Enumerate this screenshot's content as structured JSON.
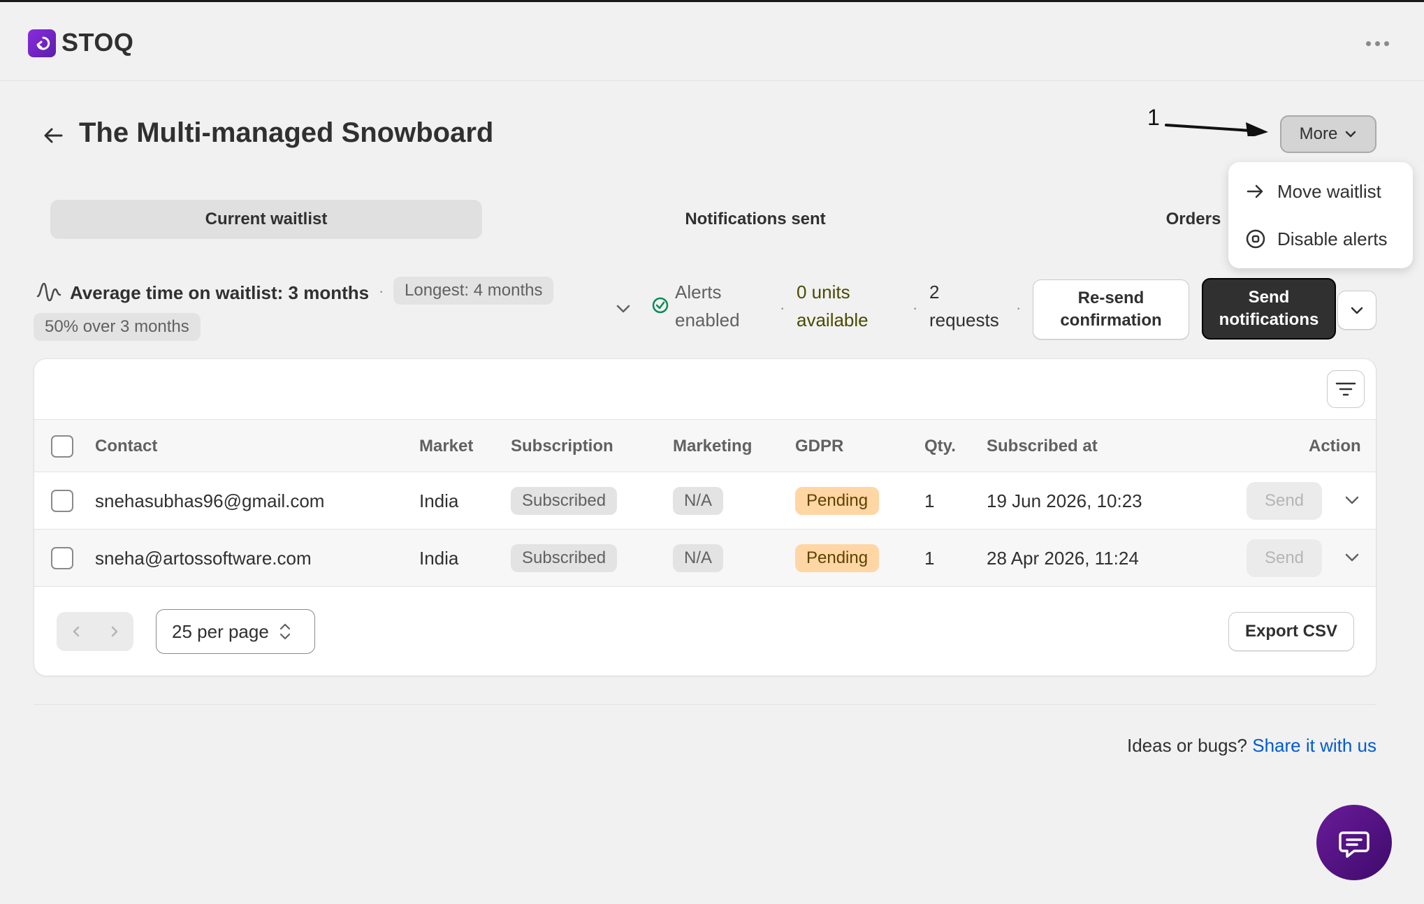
{
  "app": {
    "name": "STOQ"
  },
  "page": {
    "title": "The Multi-managed Snowboard"
  },
  "annotation": {
    "number": "1"
  },
  "more_menu": {
    "label": "More",
    "items": [
      {
        "label": "Move waitlist",
        "icon": "arrow-right-icon"
      },
      {
        "label": "Disable alerts",
        "icon": "stop-circle-icon"
      }
    ]
  },
  "tabs": [
    {
      "label": "Current waitlist",
      "active": true
    },
    {
      "label": "Notifications sent",
      "active": false
    },
    {
      "label": "Orders",
      "active": false
    }
  ],
  "stats": {
    "avg_label": "Average time on waitlist: 3 months",
    "longest": "Longest: 4 months",
    "over": "50% over 3 months",
    "alerts_line1": "Alerts",
    "alerts_line2": "enabled",
    "units_line1": "0 units",
    "units_line2": "available",
    "requests_line1": "2",
    "requests_line2": "requests"
  },
  "actions": {
    "resend_line1": "Re-send",
    "resend_line2": "confirmation",
    "send_line1": "Send",
    "send_line2": "notifications"
  },
  "table": {
    "columns": [
      "Contact",
      "Market",
      "Subscription",
      "Marketing",
      "GDPR",
      "Qty.",
      "Subscribed at",
      "Action"
    ],
    "rows": [
      {
        "contact": "snehasubhas96@gmail.com",
        "market": "India",
        "subscription": "Subscribed",
        "marketing": "N/A",
        "gdpr": "Pending",
        "qty": "1",
        "subscribed_at": "19 Jun 2026, 10:23",
        "action": "Send"
      },
      {
        "contact": "sneha@artossoftware.com",
        "market": "India",
        "subscription": "Subscribed",
        "marketing": "N/A",
        "gdpr": "Pending",
        "qty": "1",
        "subscribed_at": "28 Apr 2026, 11:24",
        "action": "Send"
      }
    ]
  },
  "pagination": {
    "per_page": "25 per page"
  },
  "export": {
    "label": "Export CSV"
  },
  "footer": {
    "text": "Ideas or bugs?",
    "link": "Share it with us"
  },
  "colors": {
    "accent": "#6a1b9a",
    "pending_badge": "#ffd6a4",
    "link": "#005bd3",
    "primary_button": "#303030"
  }
}
